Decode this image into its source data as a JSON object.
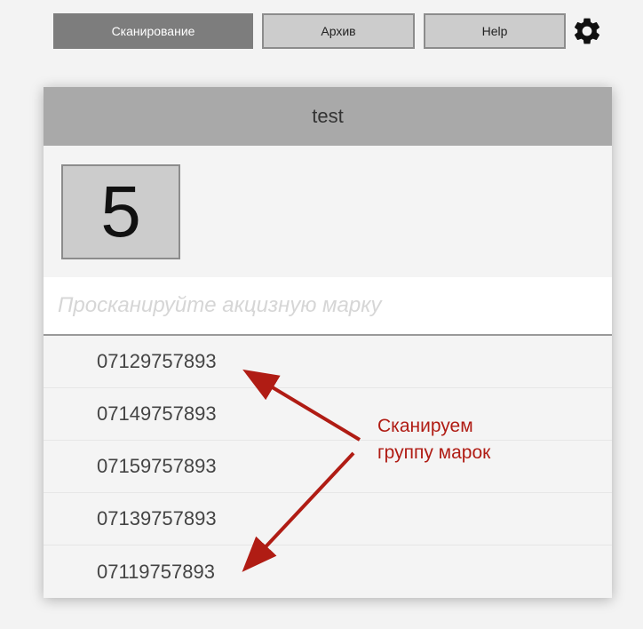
{
  "nav": {
    "scan_label": "Сканирование",
    "archive_label": "Архив",
    "help_label": "Help",
    "settings_icon": "gear-icon"
  },
  "card": {
    "title": "test",
    "count": "5",
    "input_placeholder": "Просканируйте акцизную марку",
    "input_value": "",
    "codes": [
      "07129757893",
      "07149757893",
      "07159757893",
      "07139757893",
      "07119757893"
    ]
  },
  "annotation": {
    "line1": "Сканируем",
    "line2": "группу марок",
    "color": "#b01c14"
  },
  "colors": {
    "active_tab": "#7d7d7d",
    "tab": "#cccccc",
    "header": "#a9a9a9"
  }
}
